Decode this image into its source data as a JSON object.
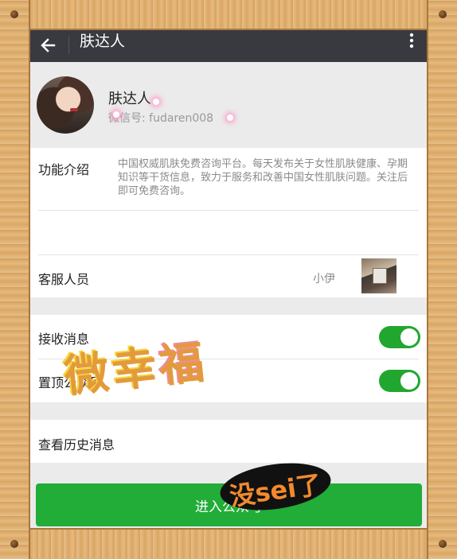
{
  "header": {
    "title": "肤达人"
  },
  "profile": {
    "name": "肤达人",
    "wechat_id": "微信号: fudaren008"
  },
  "intro": {
    "label": "功能介绍",
    "text": "中国权威肌肤免费咨询平台。每天发布关于女性肌肤健康、孕期知识等干货信息，致力于服务和改善中国女性肌肤问题。关注后即可免费咨询。"
  },
  "service": {
    "label": "客服人员",
    "name": "小伊"
  },
  "settings": {
    "receive_label": "接收消息",
    "receive_on": true,
    "pin_label": "置顶公众号",
    "pin_on": true
  },
  "history": {
    "label": "查看历史消息"
  },
  "action": {
    "enter_label": "进入公众号"
  },
  "watermark": {
    "main": "微幸福",
    "sticker": "没sei了"
  },
  "colors": {
    "titlebar": "#393a3f",
    "accent_green": "#22ac38",
    "background": "#ebebeb"
  }
}
